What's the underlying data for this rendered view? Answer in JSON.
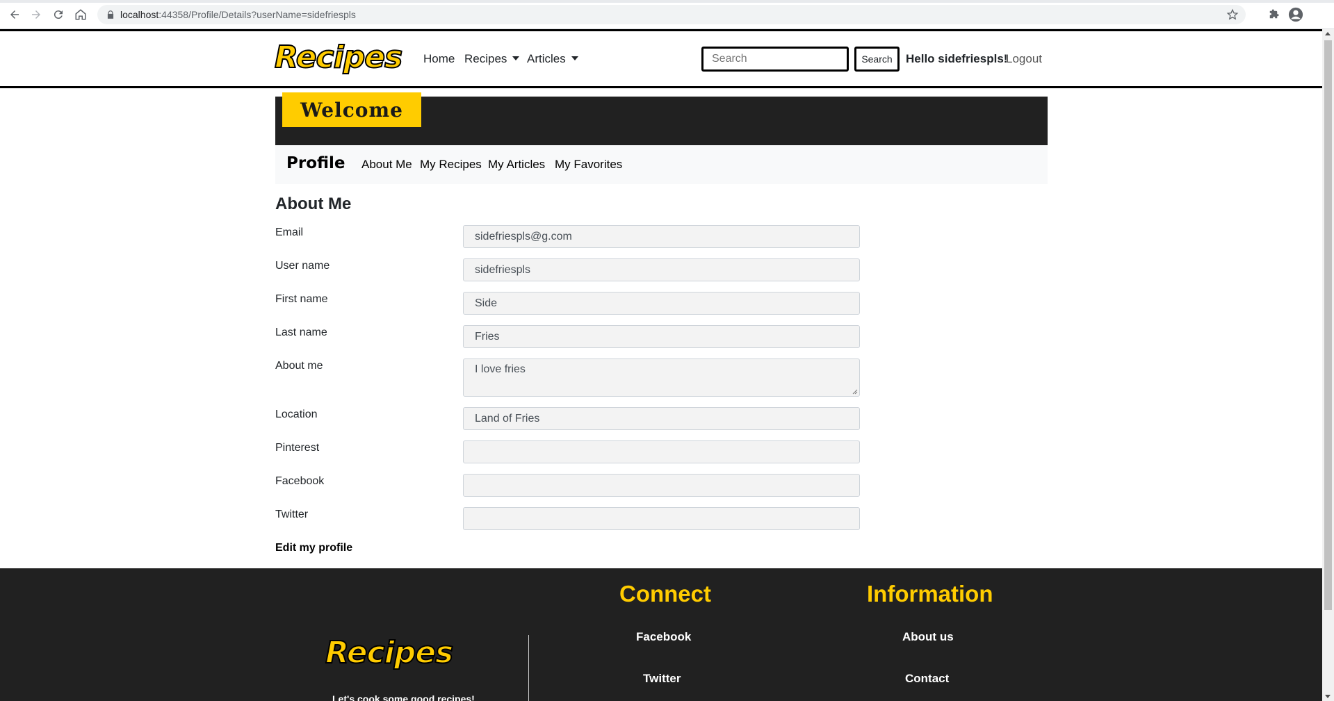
{
  "browser": {
    "url_host": "localhost",
    "url_rest": ":44358/Profile/Details?userName=sidefriespls"
  },
  "header": {
    "logo": "Recipes",
    "nav": {
      "home": "Home",
      "recipes": "Recipes",
      "articles": "Articles"
    },
    "search_placeholder": "Search",
    "search_button": "Search",
    "greeting": "Hello sidefriespls!",
    "logout": "Logout"
  },
  "banner": {
    "welcome": "Welcome"
  },
  "profile_nav": {
    "title": "Profile",
    "tabs": [
      "About Me",
      "My Recipes",
      "My Articles",
      "My Favorites"
    ]
  },
  "about": {
    "title": "About Me",
    "fields": {
      "email": {
        "label": "Email",
        "value": "sidefriespls@g.com"
      },
      "username": {
        "label": "User name",
        "value": "sidefriespls"
      },
      "first_name": {
        "label": "First name",
        "value": "Side"
      },
      "last_name": {
        "label": "Last name",
        "value": "Fries"
      },
      "about_me": {
        "label": "About me",
        "value": "I love fries"
      },
      "location": {
        "label": "Location",
        "value": "Land of Fries"
      },
      "pinterest": {
        "label": "Pinterest",
        "value": ""
      },
      "facebook": {
        "label": "Facebook",
        "value": ""
      },
      "twitter": {
        "label": "Twitter",
        "value": ""
      }
    },
    "edit_link": "Edit my profile"
  },
  "footer": {
    "logo": "Recipes",
    "tagline": "Let's cook some good recipes!",
    "connect": {
      "heading": "Connect",
      "links": [
        "Facebook",
        "Twitter"
      ]
    },
    "information": {
      "heading": "Information",
      "links": [
        "About us",
        "Contact"
      ]
    }
  },
  "colors": {
    "brand_yellow": "#FFCC00",
    "dark": "#212121",
    "light_bg": "#f8f9fa"
  }
}
